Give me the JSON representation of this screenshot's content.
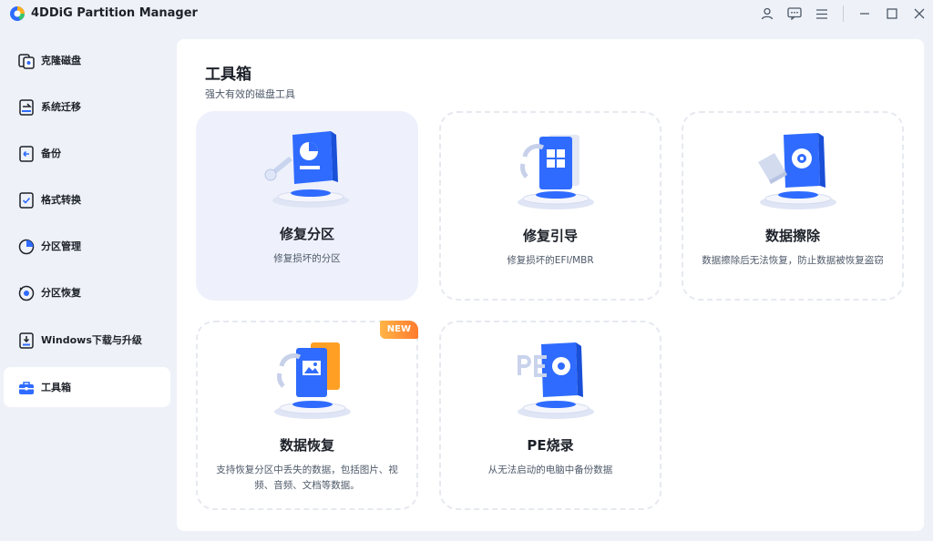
{
  "app": {
    "title": "4DDiG Partition Manager"
  },
  "titlebar": {
    "icons": [
      "account-icon",
      "feedback-icon",
      "menu-icon",
      "minimize-icon",
      "maximize-icon",
      "close-icon"
    ]
  },
  "sidebar": {
    "items": [
      {
        "label": "克隆磁盘",
        "icon": "clone-disk-icon",
        "active": false
      },
      {
        "label": "系统迁移",
        "icon": "system-migrate-icon",
        "active": false
      },
      {
        "label": "备份",
        "icon": "backup-icon",
        "active": false
      },
      {
        "label": "格式转换",
        "icon": "format-convert-icon",
        "active": false
      },
      {
        "label": "分区管理",
        "icon": "partition-manage-icon",
        "active": false
      },
      {
        "label": "分区恢复",
        "icon": "partition-recover-icon",
        "active": false
      },
      {
        "label": "Windows下载与升级",
        "icon": "windows-download-icon",
        "active": false
      },
      {
        "label": "工具箱",
        "icon": "toolbox-icon",
        "active": true
      }
    ]
  },
  "main": {
    "title": "工具箱",
    "subtitle": "强大有效的磁盘工具",
    "cards": [
      {
        "title": "修复分区",
        "desc": "修复损坏的分区",
        "icon": "repair-partition-icon",
        "active": true
      },
      {
        "title": "修复引导",
        "desc": "修复损坏的EFI/MBR",
        "icon": "repair-boot-icon",
        "active": false
      },
      {
        "title": "数据擦除",
        "desc": "数据擦除后无法恢复，防止数据被恢复盗窃",
        "icon": "data-wipe-icon",
        "active": false
      },
      {
        "title": "数据恢复",
        "desc": "支持恢复分区中丢失的数据，包括图片、视频、音频、文档等数据。",
        "icon": "data-recovery-icon",
        "active": false,
        "badge": "NEW"
      },
      {
        "title": "PE烧录",
        "desc": "从无法启动的电脑中备份数据",
        "icon": "pe-burn-icon",
        "active": false
      }
    ]
  },
  "colors": {
    "accent": "#2f6bff",
    "sidebar_bg": "#eef2f8",
    "badge": "#ff8a3d"
  }
}
